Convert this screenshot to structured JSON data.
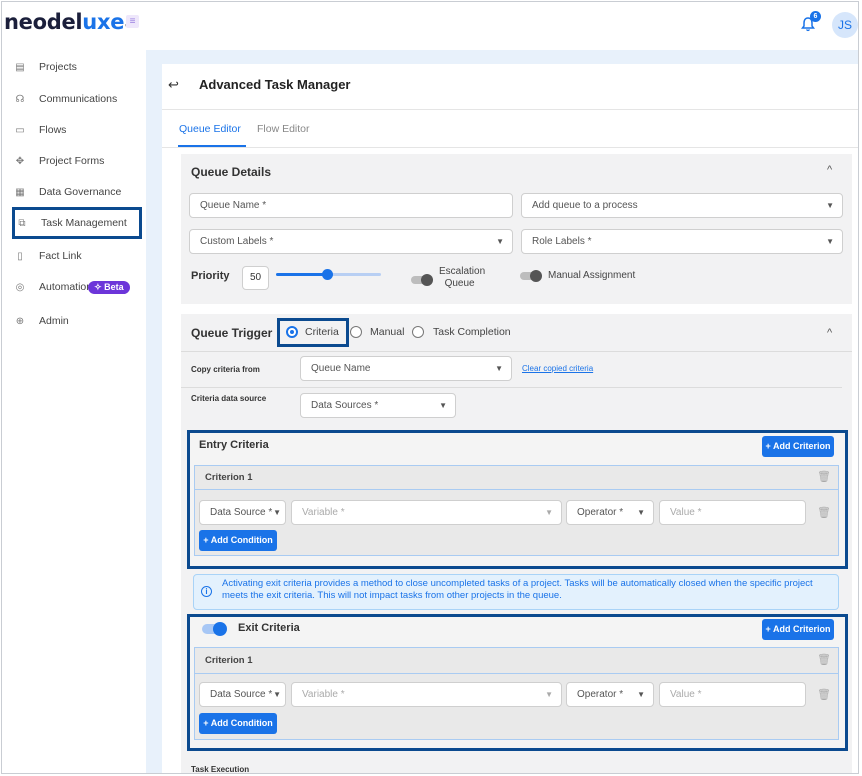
{
  "app": {
    "logo_main": "neodel",
    "logo_accent": "uxe",
    "logo_tm": "™",
    "notification_count": "6",
    "avatar_initials": "JS"
  },
  "sidebar": {
    "items": [
      {
        "label": "Projects",
        "icon": "clipboard-icon",
        "glyph": "▤"
      },
      {
        "label": "Communications",
        "icon": "chat-icon",
        "glyph": "☊"
      },
      {
        "label": "Flows",
        "icon": "flows-icon",
        "glyph": "▭"
      },
      {
        "label": "Project Forms",
        "icon": "forms-icon",
        "glyph": "✥"
      },
      {
        "label": "Data Governance",
        "icon": "grid-icon",
        "glyph": "▦"
      },
      {
        "label": "Task Management",
        "icon": "task-icon",
        "glyph": "⧉"
      },
      {
        "label": "Fact Link",
        "icon": "document-icon",
        "glyph": "▯"
      },
      {
        "label": "Automation",
        "icon": "automation-icon",
        "glyph": "◎",
        "badge": "Beta"
      },
      {
        "label": "Admin",
        "icon": "admin-icon",
        "glyph": "⊕"
      }
    ]
  },
  "page": {
    "title": "Advanced Task Manager",
    "tabs": [
      {
        "label": "Queue Editor",
        "active": true
      },
      {
        "label": "Flow Editor",
        "active": false
      }
    ]
  },
  "queue_details": {
    "title": "Queue Details",
    "queue_name_placeholder": "Queue Name *",
    "process_placeholder": "Add queue to a process",
    "custom_labels_placeholder": "Custom Labels *",
    "role_labels_placeholder": "Role Labels *",
    "priority_label": "Priority",
    "priority_value": "50",
    "priority_fraction": 0.5,
    "escalation_line1": "Escalation",
    "escalation_line2": "Queue",
    "manual_assignment": "Manual Assignment"
  },
  "queue_trigger": {
    "title": "Queue Trigger",
    "options": [
      "Criteria",
      "Manual",
      "Task Completion"
    ],
    "selected": "Criteria",
    "copy_label": "Copy criteria from",
    "copy_placeholder": "Queue Name",
    "clear_link": "Clear copied criteria",
    "source_label": "Criteria data source",
    "source_placeholder": "Data Sources *"
  },
  "entry_criteria": {
    "title": "Entry Criteria",
    "add_criterion": "+ Add Criterion",
    "criterion_title": "Criterion 1",
    "data_source": "Data Source *",
    "variable": "Variable *",
    "operator": "Operator *",
    "value": "Value *",
    "add_condition": "+ Add Condition"
  },
  "info_message": "Activating exit criteria provides a method to close uncompleted tasks of a project. Tasks will be automatically closed when the specific project meets the exit criteria. This will not impact tasks from other projects in the queue.",
  "exit_criteria": {
    "title": "Exit Criteria",
    "enabled": true,
    "add_criterion": "+ Add Criterion",
    "criterion_title": "Criterion 1",
    "data_source": "Data Source *",
    "variable": "Variable *",
    "operator": "Operator *",
    "value": "Value *",
    "add_condition": "+ Add Condition"
  },
  "task_execution_label": "Task Execution"
}
